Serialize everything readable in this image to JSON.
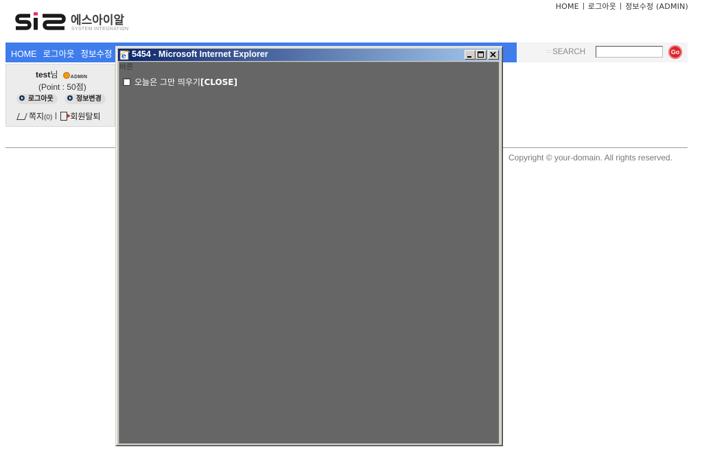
{
  "top_links": [
    "HOME",
    "로그아웃",
    "정보수정 (ADMIN)"
  ],
  "logo": {
    "korean": "에스아이알",
    "english": "SYSTEM INTEGRATION",
    "colors": {
      "dark": "#1a1a1a",
      "accent": "#e0306a"
    }
  },
  "nav": {
    "items": [
      "HOME",
      "로그아웃",
      "정보수정"
    ],
    "bar_color": "#3f7ded"
  },
  "search": {
    "label": "SEARCH",
    "value": "",
    "go_label": "Go"
  },
  "login_box": {
    "username": "test",
    "suffix": "님",
    "badge": "ADMIN",
    "point": "(Point : 50점)",
    "logout_label": "로그아웃",
    "edit_label": "정보변경",
    "memo_label": "쪽지",
    "memo_count": "(0)",
    "withdraw_label": "회원탈퇴"
  },
  "footer": {
    "copyright": "Copyright © your-domain. All rights reserved."
  },
  "popup": {
    "title": "5454 - Microsoft Internet Explorer",
    "top_text": "바른",
    "checkbox_label": "오늘은 그만 띄우기",
    "close_label": "[CLOSE]",
    "background": "#666666",
    "controls": [
      "minimize-icon",
      "maximize-icon",
      "close-icon"
    ]
  }
}
